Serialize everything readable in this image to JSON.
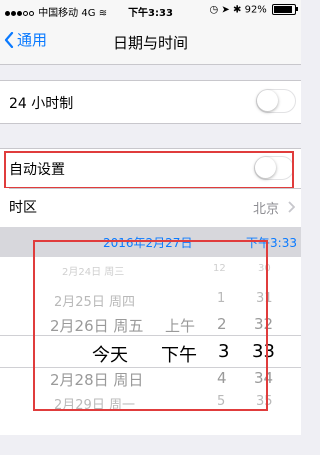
{
  "status_bar": {
    "carrier": "中国移动",
    "network": "4G",
    "time": "下午3:33",
    "battery": "92%"
  },
  "nav": {
    "back_label": "通用",
    "title": "日期与时间"
  },
  "settings": {
    "hour24_label": "24 小时制",
    "hour24_on": false,
    "auto_label": "自动设置",
    "auto_on": false,
    "timezone_label": "时区",
    "timezone_value": "北京"
  },
  "datetime": {
    "date": "2016年2月27日",
    "time": "下午3:33"
  },
  "picker": {
    "dates": [
      "2月24日 周三",
      "2月25日 周四",
      "2月26日 周五",
      "今天",
      "2月28日 周日",
      "2月29日 周一"
    ],
    "ampm": [
      "上午",
      "下午"
    ],
    "hours": [
      "12",
      "1",
      "2",
      "3",
      "4",
      "5"
    ],
    "minutes": [
      "30",
      "31",
      "32",
      "33",
      "34",
      "35"
    ],
    "selected": {
      "date": "今天",
      "ampm": "下午",
      "hour": "3",
      "minute": "33"
    }
  },
  "colors": {
    "accent": "#0a7aff",
    "highlight_box": "#e03c3c"
  }
}
